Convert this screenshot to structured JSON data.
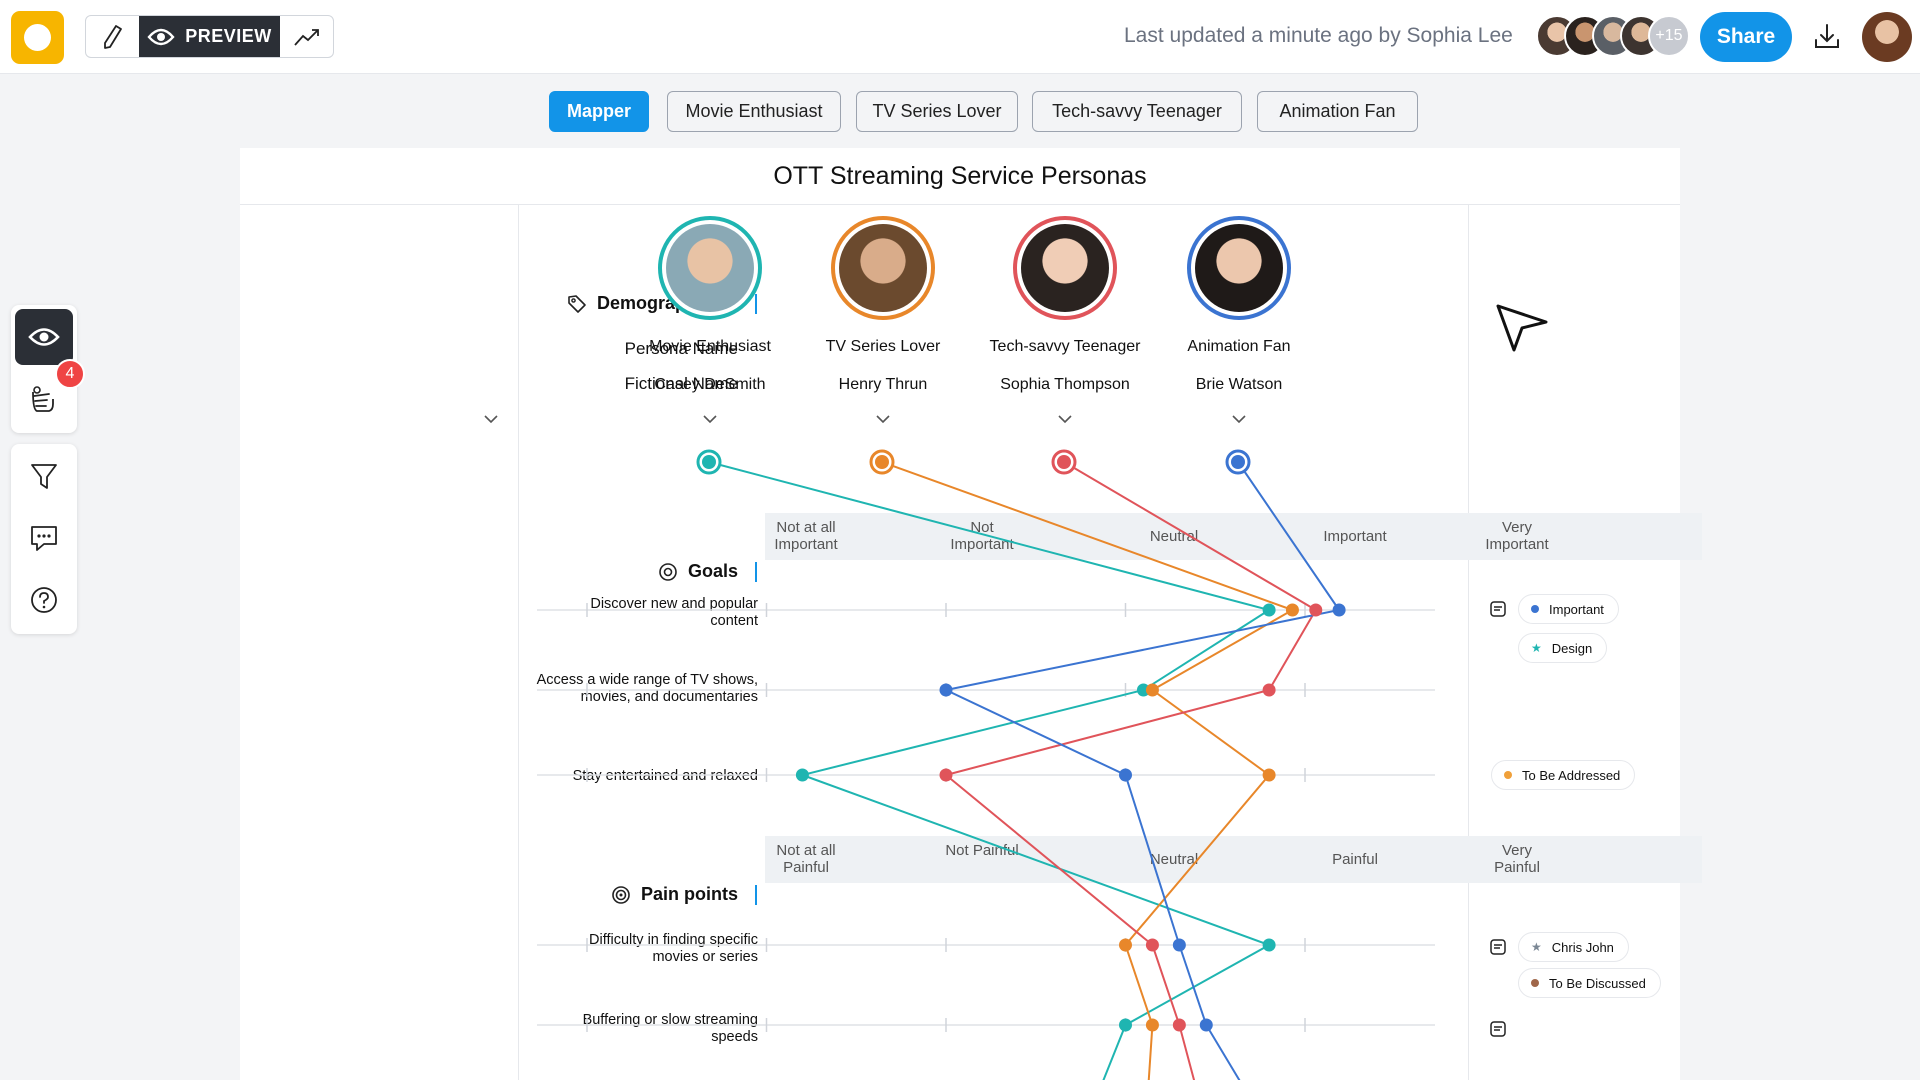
{
  "topbar": {
    "preview_label": "PREVIEW",
    "updated_text": "Last updated a minute ago by Sophia Lee",
    "more_collaborators": "+15",
    "share_label": "Share"
  },
  "tabs": [
    "Mapper",
    "Movie Enthusiast",
    "TV Series Lover",
    "Tech-savvy Teenager",
    "Animation Fan"
  ],
  "left_toolbar": {
    "badge_count": "4"
  },
  "canvas": {
    "title": "OTT Streaming Service Personas",
    "demographics": {
      "title": "Demographics",
      "persona_name_label": "Persona Name",
      "fictional_name_label": "Fictional Name"
    },
    "personas": [
      {
        "role": "Movie Enthusiast",
        "name": "Casey DeSmith",
        "color": "#1fb5b1"
      },
      {
        "role": "TV Series Lover",
        "name": "Henry Thrun",
        "color": "#e8872a"
      },
      {
        "role": "Tech-savvy Teenager",
        "name": "Sophia Thompson",
        "color": "#e0545a"
      },
      {
        "role": "Animation Fan",
        "name": "Brie Watson",
        "color": "#3b74d1"
      }
    ],
    "goals": {
      "title": "Goals",
      "scale": [
        "Not at all Important",
        "Not Important",
        "Neutral",
        "Important",
        "Very Important"
      ],
      "rows": [
        "Discover new and popular content",
        "Access a wide range of TV shows, movies, and documentaries",
        "Stay entertained and relaxed"
      ]
    },
    "pain_points": {
      "title": "Pain points",
      "scale": [
        "Not at all Painful",
        "Not Painful",
        "Neutral",
        "Painful",
        "Very Painful"
      ],
      "rows": [
        "Difficulty in finding specific movies or series",
        "Buffering or slow streaming speeds"
      ]
    },
    "ratings": {
      "note": "value = scale position 1..5 per row, per persona (goals rows then pain rows)",
      "movie_enthusiast": [
        4.8,
        4.1,
        2.2,
        4.8,
        4.0
      ],
      "tv_series_lover": [
        4.93,
        4.15,
        4.8,
        4.0,
        4.15
      ],
      "tech_savvy_teenager": [
        5.06,
        4.8,
        3.0,
        4.15,
        4.3
      ],
      "animation_fan": [
        5.19,
        3.0,
        4.0,
        4.3,
        4.45
      ]
    },
    "tags": {
      "important": "Important",
      "design": "Design",
      "to_be_addressed": "To Be Addressed",
      "chris_john": "Chris John",
      "to_be_discussed": "To Be Discussed"
    },
    "colors": {
      "accent": "#1294e8",
      "important_dot": "#3b74d1",
      "design_star": "#1fb5b1",
      "addressed_dot": "#f0a03a",
      "discussed_dot": "#a0674a",
      "chris_star": "#7b8794"
    }
  }
}
